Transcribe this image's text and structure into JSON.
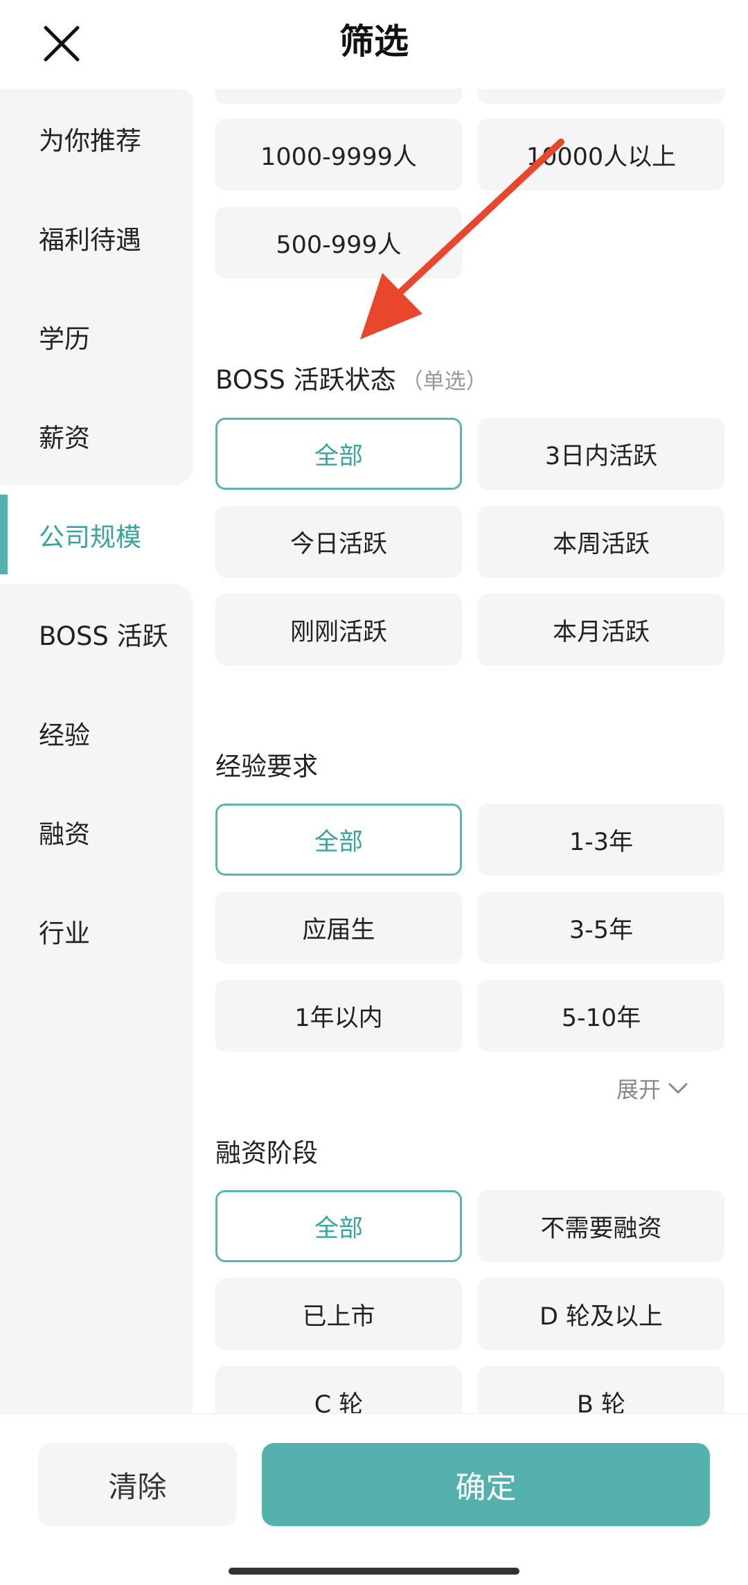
{
  "header": {
    "title": "筛选"
  },
  "sidebar": {
    "items": [
      {
        "label": "为你推荐"
      },
      {
        "label": "福利待遇"
      },
      {
        "label": "学历"
      },
      {
        "label": "薪资"
      },
      {
        "label": "公司规模",
        "active": true
      },
      {
        "label": "BOSS 活跃"
      },
      {
        "label": "经验"
      },
      {
        "label": "融资"
      },
      {
        "label": "行业"
      }
    ]
  },
  "company_size": {
    "options": [
      "1000-9999人",
      "10000人以上",
      "500-999人"
    ]
  },
  "boss_active": {
    "title": "BOSS 活跃状态",
    "hint": "（单选）",
    "options": [
      "全部",
      "3日内活跃",
      "今日活跃",
      "本周活跃",
      "刚刚活跃",
      "本月活跃"
    ],
    "selected": "全部"
  },
  "experience": {
    "title": "经验要求",
    "options": [
      "全部",
      "1-3年",
      "应届生",
      "3-5年",
      "1年以内",
      "5-10年"
    ],
    "selected": "全部",
    "expand_label": "展开"
  },
  "funding": {
    "title": "融资阶段",
    "options": [
      "全部",
      "不需要融资",
      "已上市",
      "D 轮及以上",
      "C 轮",
      "B 轮"
    ],
    "selected": "全部"
  },
  "footer": {
    "clear_label": "清除",
    "confirm_label": "确定"
  },
  "colors": {
    "accent": "#52b1ae",
    "accent_text": "#3aa3a0",
    "annotation_arrow": "#e8472e"
  },
  "icons": {
    "close": "close-icon",
    "expand": "chevron-down-icon"
  }
}
